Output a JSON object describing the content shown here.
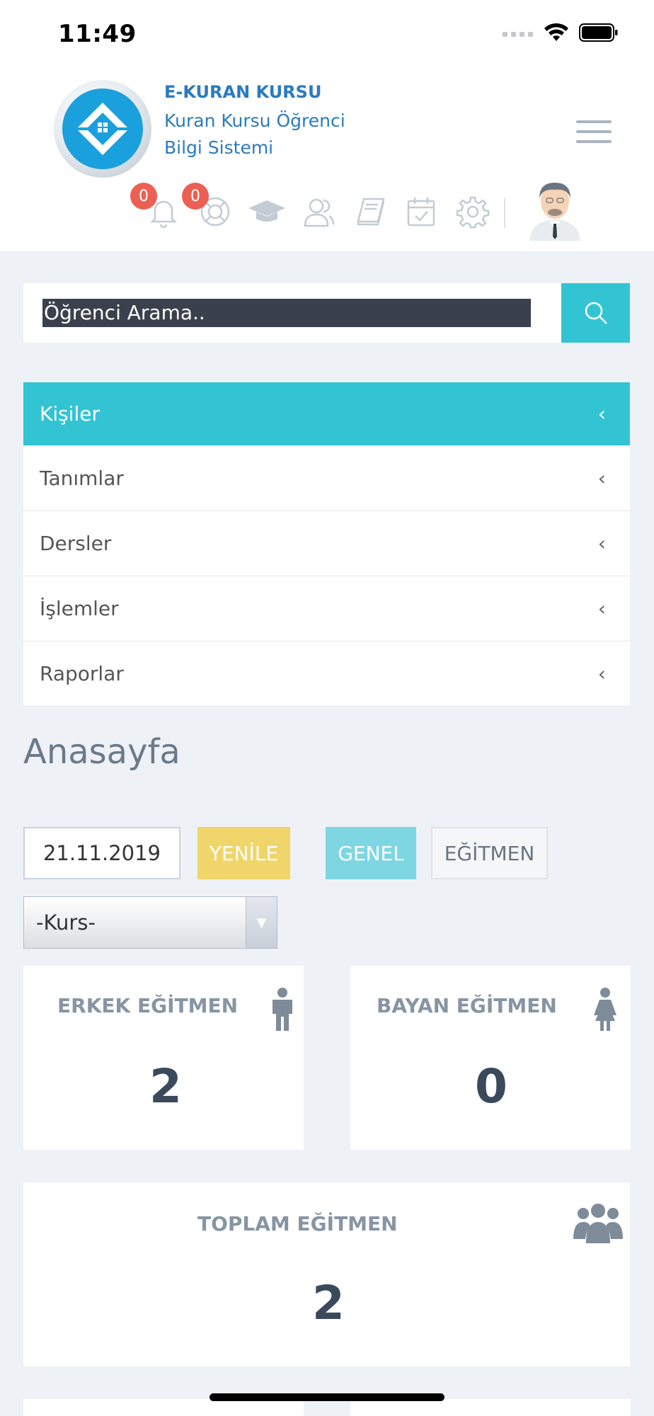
{
  "status_bar": {
    "time": "11:49"
  },
  "header": {
    "brand_title": "E-KURAN KURSU",
    "brand_subtitle": "Kuran Kursu Öğrenci Bilgi Sistemi",
    "notifications_count": "0",
    "messages_count": "0"
  },
  "search": {
    "placeholder": "Öğrenci Arama.."
  },
  "menu": {
    "items": [
      {
        "label": "Kişiler",
        "active": true
      },
      {
        "label": "Tanımlar"
      },
      {
        "label": "Dersler"
      },
      {
        "label": "İşlemler"
      },
      {
        "label": "Raporlar"
      }
    ]
  },
  "page": {
    "title": "Anasayfa"
  },
  "filters": {
    "date": "21.11.2019",
    "refresh_label": "YENİLE",
    "general_label": "GENEL",
    "instructor_label": "EĞİTMEN",
    "course_select": "-Kurs-"
  },
  "stats": {
    "male": {
      "label": "ERKEK EĞİTMEN",
      "value": "2"
    },
    "female": {
      "label": "BAYAN EĞİTMEN",
      "value": "0"
    },
    "total": {
      "label": "TOPLAM EĞİTMEN",
      "value": "2"
    }
  },
  "colors": {
    "accent": "#32c4d3",
    "brand": "#2b7bbd",
    "badge": "#ec5f53",
    "refresh_button": "#f0d66a"
  },
  "icons": [
    "bell-icon",
    "lifebuoy-icon",
    "graduation-cap-icon",
    "users-icon",
    "book-icon",
    "calendar-check-icon",
    "gear-icon",
    "search-icon",
    "male-icon",
    "female-icon",
    "group-icon"
  ]
}
